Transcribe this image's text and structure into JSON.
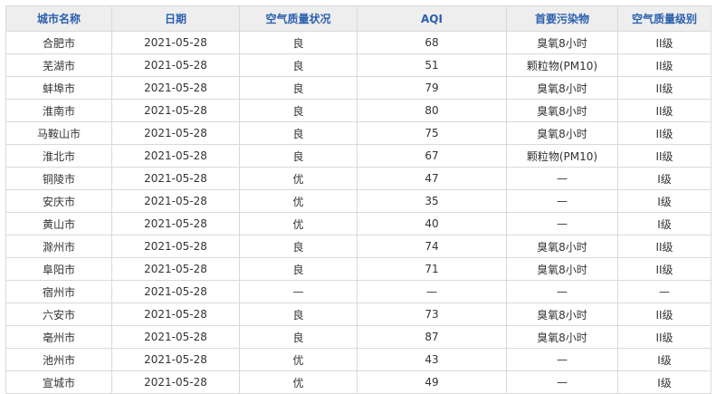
{
  "table": {
    "headers": [
      "城市名称",
      "日期",
      "空气质量状况",
      "AQI",
      "首要污染物",
      "空气质量级别"
    ],
    "rows": [
      [
        "合肥市",
        "2021-05-28",
        "良",
        "68",
        "臭氧8小时",
        "II级"
      ],
      [
        "芜湖市",
        "2021-05-28",
        "良",
        "51",
        "颗粒物(PM10)",
        "II级"
      ],
      [
        "蚌埠市",
        "2021-05-28",
        "良",
        "79",
        "臭氧8小时",
        "II级"
      ],
      [
        "淮南市",
        "2021-05-28",
        "良",
        "80",
        "臭氧8小时",
        "II级"
      ],
      [
        "马鞍山市",
        "2021-05-28",
        "良",
        "75",
        "臭氧8小时",
        "II级"
      ],
      [
        "淮北市",
        "2021-05-28",
        "良",
        "67",
        "颗粒物(PM10)",
        "II级"
      ],
      [
        "铜陵市",
        "2021-05-28",
        "优",
        "47",
        "—",
        "I级"
      ],
      [
        "安庆市",
        "2021-05-28",
        "优",
        "35",
        "—",
        "I级"
      ],
      [
        "黄山市",
        "2021-05-28",
        "优",
        "40",
        "—",
        "I级"
      ],
      [
        "滁州市",
        "2021-05-28",
        "良",
        "74",
        "臭氧8小时",
        "II级"
      ],
      [
        "阜阳市",
        "2021-05-28",
        "良",
        "71",
        "臭氧8小时",
        "II级"
      ],
      [
        "宿州市",
        "2021-05-28",
        "—",
        "—",
        "—",
        "—"
      ],
      [
        "六安市",
        "2021-05-28",
        "良",
        "73",
        "臭氧8小时",
        "II级"
      ],
      [
        "亳州市",
        "2021-05-28",
        "良",
        "87",
        "臭氧8小时",
        "II级"
      ],
      [
        "池州市",
        "2021-05-28",
        "优",
        "43",
        "—",
        "I级"
      ],
      [
        "宣城市",
        "2021-05-28",
        "优",
        "49",
        "—",
        "I级"
      ]
    ]
  },
  "colors": {
    "header_text": "#2a5fae",
    "header_bg": "#eeeeee",
    "border": "#d9d9d9",
    "cell_text": "#333333"
  }
}
